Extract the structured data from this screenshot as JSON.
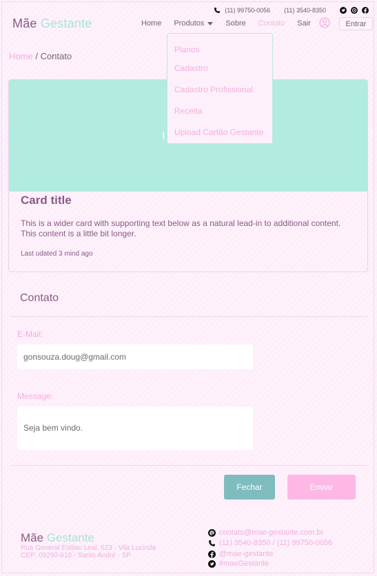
{
  "topbar": {
    "phone1": "(11) 99750-0056",
    "phone2": "(11) 3540-8350",
    "icons": [
      "phone-icon",
      "twitter-icon",
      "whatsapp-icon",
      "facebook-icon"
    ]
  },
  "brand": {
    "part1": "Mãe",
    "part2": "Gestante"
  },
  "nav": {
    "home": "Home",
    "produtos": "Produtos",
    "sobre": "Sobre",
    "contato": "Contato",
    "sair": "Sair",
    "entrar": "Entrar"
  },
  "dropdown": {
    "items": [
      "Planos",
      "Cadastro",
      "Cadastro Profissional",
      "Receita",
      "Upload Cartão Gestante"
    ]
  },
  "breadcrumb": {
    "home": "Home",
    "separator": "/",
    "current": "Contato"
  },
  "card": {
    "image_text": "I",
    "title": "Card title",
    "text": "This is a wider card with supporting text below as a natural lead-in to additional content. This content is a little bit longer.",
    "meta": "Last udated 3 mind ago"
  },
  "contact": {
    "title": "Contato",
    "email_label": "E-Mail:",
    "email_value": "gonsouza.doug@gmail.com",
    "message_label": "Message:",
    "message_value": "Seja bem vindo.",
    "close_button": "Fechar",
    "send_button": "Enviar"
  },
  "footer": {
    "brand_part1": "Mãe",
    "brand_part2": "Gestante",
    "address_line1": "Rua General Estilac Leal, 623 - Vila Lucinda",
    "address_line2": "CEP: 09250-610 - Santo André - SP",
    "email": "contato@mae-gestante.com.br",
    "phones": "(11) 3540-8350 / (11) 99750-0056",
    "facebook": "@mae-gestante",
    "twitter": "#maeGestante"
  },
  "colors": {
    "background": "#fdeefa",
    "brand_purple": "#8a5a86",
    "brand_mint": "#a9e3da",
    "pink_accent": "#f2addf",
    "teal_button": "#7fbcbf",
    "pink_button": "#fdb8e6"
  }
}
